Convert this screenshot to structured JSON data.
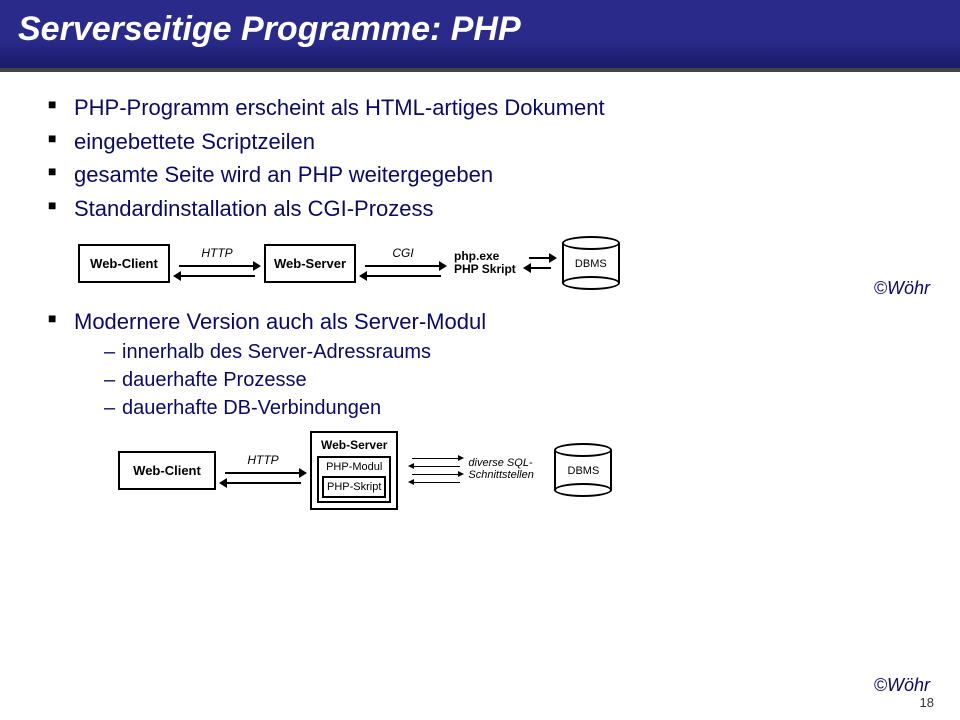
{
  "title": "Serverseitige Programme: PHP",
  "bullets_top": [
    "PHP-Programm erscheint als HTML-artiges Dokument",
    "eingebettete Scriptzeilen",
    "gesamte Seite wird an PHP weitergegeben",
    "Standardinstallation als CGI-Prozess"
  ],
  "diagram1": {
    "web_client": "Web-Client",
    "http": "HTTP",
    "web_server": "Web-Server",
    "cgi": "CGI",
    "php_exe": "php.exe",
    "php_skript": "PHP Skript",
    "dbms": "DBMS"
  },
  "credit": "©Wöhr",
  "bullet_mid": "Modernere Version auch als Server-Modul",
  "sub_bullets": [
    "innerhalb des Server-Adressraums",
    "dauerhafte Prozesse",
    "dauerhafte DB-Verbindungen"
  ],
  "diagram2": {
    "web_client": "Web-Client",
    "http": "HTTP",
    "web_server": "Web-Server",
    "php_modul": "PHP-Modul",
    "php_skript": "PHP-Skript",
    "sql_label": "diverse SQL-Schnittstellen",
    "dbms": "DBMS"
  },
  "page_number": "18"
}
